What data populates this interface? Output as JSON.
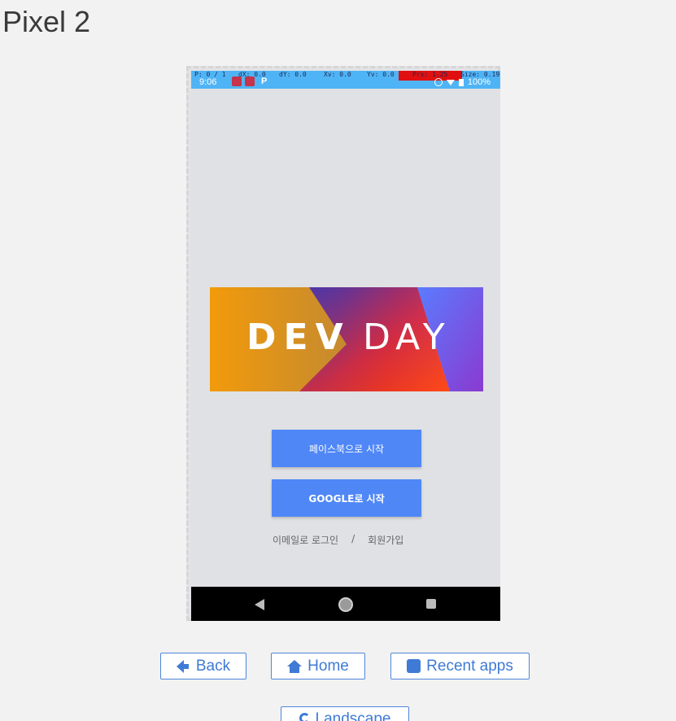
{
  "page": {
    "title": "Pixel 2"
  },
  "status_bar": {
    "debug": [
      "P: 0 / 1",
      "dX: 0.0",
      "dY: 0.0",
      "Xv: 0.0",
      "Yv: 0.0",
      "Prs: 1.25",
      "Size: 0.19"
    ],
    "time": "9:06",
    "battery": "100%"
  },
  "app": {
    "banner": {
      "word_left": "DEV",
      "word_right": "DAY"
    },
    "facebook_label": "페이스북으로 시작",
    "google_label": "GOOGLE로 시작",
    "email_login": "이메일로 로그인",
    "separator": "/",
    "signup": "회원가입"
  },
  "controls": {
    "back": "Back",
    "home": "Home",
    "recent": "Recent apps",
    "landscape": "Landscape"
  },
  "colors": {
    "accent": "#4f87f7",
    "status_bar": "#4fb4f5",
    "control_text": "#3f7ad6"
  },
  "icons": {
    "back": "arrow-left-icon",
    "home": "home-icon",
    "recent": "square-icon",
    "landscape": "refresh-icon"
  }
}
